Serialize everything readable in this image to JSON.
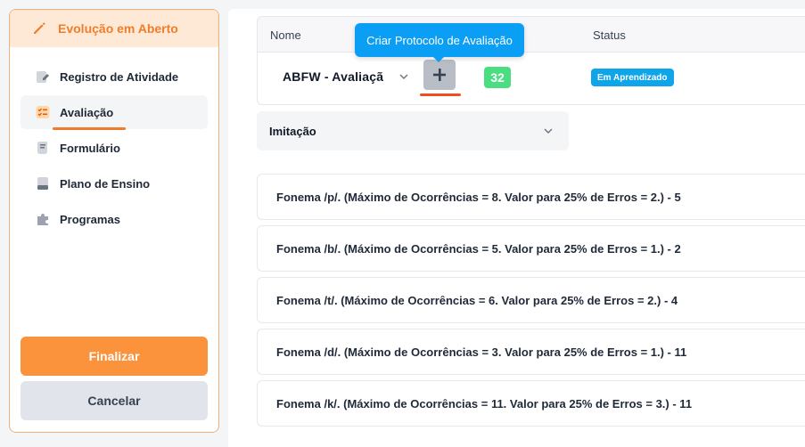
{
  "sidebar": {
    "header_title": "Evolução em Aberto",
    "items": [
      {
        "label": "Registro de Atividade",
        "icon": "pencil-note-icon"
      },
      {
        "label": "Avaliação",
        "icon": "checklist-icon"
      },
      {
        "label": "Formulário",
        "icon": "form-icon"
      },
      {
        "label": "Plano de Ensino",
        "icon": "document-icon"
      },
      {
        "label": "Programas",
        "icon": "puzzle-icon"
      }
    ],
    "active_item": "Avaliação",
    "finalizar_label": "Finalizar",
    "cancelar_label": "Cancelar"
  },
  "main": {
    "table": {
      "headers": {
        "nome": "Nome",
        "status": "Status"
      },
      "row": {
        "protocol_value": "ABFW - Avaliaçã",
        "count": "32",
        "status": "Em Aprendizado"
      }
    },
    "tooltip": "Criar Protocolo de Avaliação",
    "category": "Imitação",
    "items": [
      "Fonema /p/. (Máximo de Ocorrências = 8. Valor para 25% de Erros = 2.) - 5",
      "Fonema /b/. (Máximo de Ocorrências = 5. Valor para 25% de Erros = 1.) - 2",
      "Fonema /t/. (Máximo de Ocorrências = 6. Valor para 25% de Erros = 2.) - 4",
      "Fonema /d/. (Máximo de Ocorrências = 3. Valor para 25% de Erros = 1.) - 11",
      "Fonema /k/. (Máximo de Ocorrências = 11. Valor para 25% de Erros = 3.) - 11"
    ]
  },
  "colors": {
    "accent_orange": "#fb923c",
    "header_orange_bg": "#fde9d6",
    "tooltip_blue": "#0b9ef5",
    "count_green": "#4ade80",
    "status_blue": "#0ea5e9"
  }
}
